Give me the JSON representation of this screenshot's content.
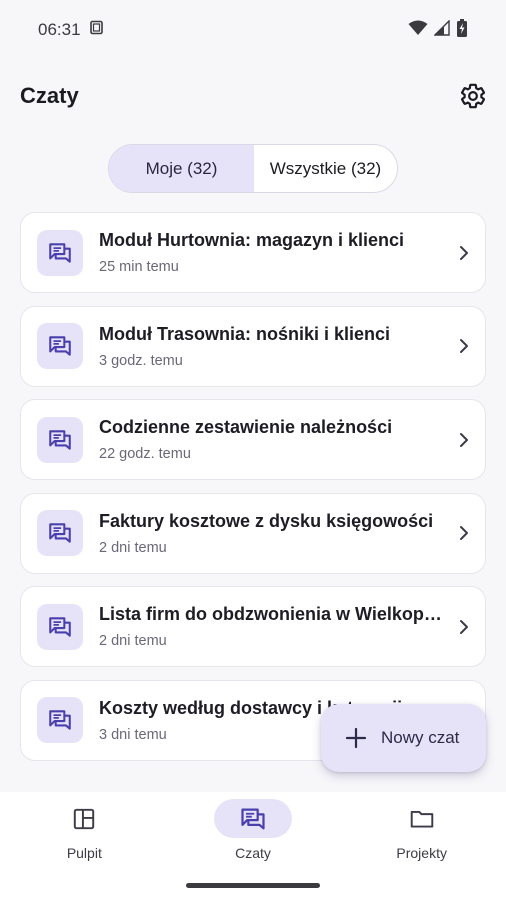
{
  "status_bar": {
    "time": "06:31"
  },
  "header": {
    "title": "Czaty"
  },
  "tabs": [
    {
      "label": "Moje (32)",
      "active": true
    },
    {
      "label": "Wszystkie (32)",
      "active": false
    }
  ],
  "chats": [
    {
      "title": "Moduł Hurtownia: magazyn i klienci",
      "time": "25 min temu"
    },
    {
      "title": "Moduł Trasownia: nośniki i klienci",
      "time": "3 godz. temu"
    },
    {
      "title": "Codzienne zestawienie należności",
      "time": "22 godz. temu"
    },
    {
      "title": "Faktury kosztowe z dysku księgowości",
      "time": "2 dni temu"
    },
    {
      "title": "Lista firm do obdzwonienia w Wielkopolsce",
      "time": "2 dni temu"
    },
    {
      "title": "Koszty według dostawcy i kategorii",
      "time": "3 dni temu"
    }
  ],
  "fab": {
    "label": "Nowy czat"
  },
  "nav": [
    {
      "label": "Pulpit",
      "icon": "dashboard-icon",
      "active": false
    },
    {
      "label": "Czaty",
      "icon": "chat-icon",
      "active": true
    },
    {
      "label": "Projekty",
      "icon": "folder-icon",
      "active": false
    }
  ],
  "colors": {
    "accent": "#5b4fc4",
    "accent_container": "#e6e3f8",
    "background": "#f7f7fa"
  }
}
